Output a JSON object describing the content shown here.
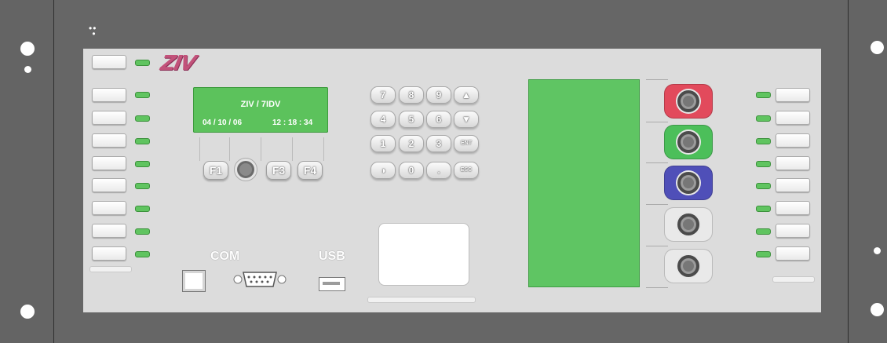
{
  "panel": {
    "brand_logo": "ZIV",
    "lcd": {
      "line1": "ZIV / 7IDV",
      "date": "04 / 10 / 06",
      "time": "12 : 18 : 34"
    },
    "function_keys": [
      "F1",
      "F3",
      "F4"
    ],
    "keypad": [
      "7",
      "8",
      "9",
      "▲",
      "4",
      "5",
      "6",
      "▼",
      "1",
      "2",
      "3",
      "ENT",
      "◑",
      "0",
      ".",
      "ESC"
    ],
    "ports": {
      "com_label": "COM",
      "usb_label": "USB"
    },
    "switch_colors": [
      "#e24a5c",
      "#4cbf5a",
      "#4f4fb8",
      "#e9e9e9",
      "#e9e9e9"
    ],
    "led_color": "#60c460",
    "screen_color": "#5fc563"
  }
}
